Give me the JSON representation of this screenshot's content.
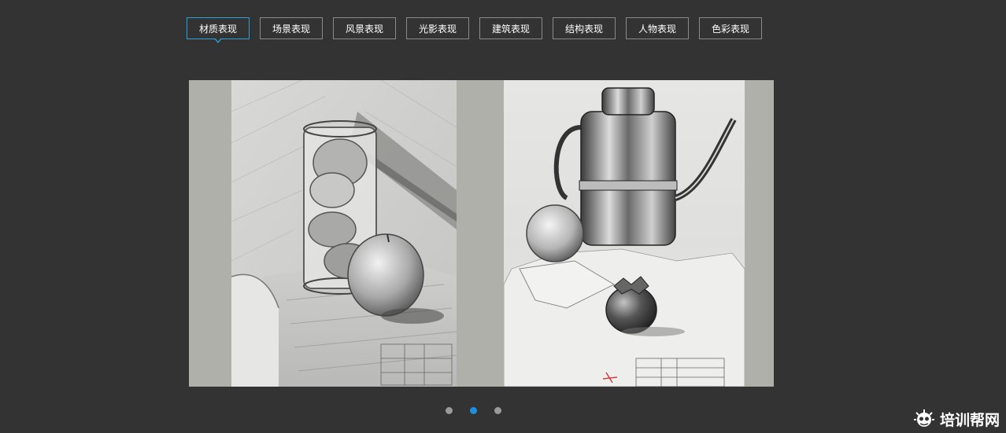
{
  "tabs": [
    {
      "label": "材质表现",
      "active": true
    },
    {
      "label": "场景表现",
      "active": false
    },
    {
      "label": "风景表现",
      "active": false
    },
    {
      "label": "光影表现",
      "active": false
    },
    {
      "label": "建筑表现",
      "active": false
    },
    {
      "label": "结构表现",
      "active": false
    },
    {
      "label": "人物表现",
      "active": false
    },
    {
      "label": "色彩表现",
      "active": false
    }
  ],
  "slider": {
    "active_index": 1,
    "total": 3,
    "images": [
      {
        "subject": "glass-with-fruit-and-apple-sketch"
      },
      {
        "subject": "kettle-with-apple-and-persimmon-sketch"
      }
    ]
  },
  "watermark": {
    "text": "培训帮网",
    "icon": "cartoon-logo-icon"
  },
  "colors": {
    "background": "#333333",
    "active_tab_border": "#2aa1db",
    "active_dot": "#1d8fe0",
    "inactive_dot": "#9a9a9a"
  }
}
